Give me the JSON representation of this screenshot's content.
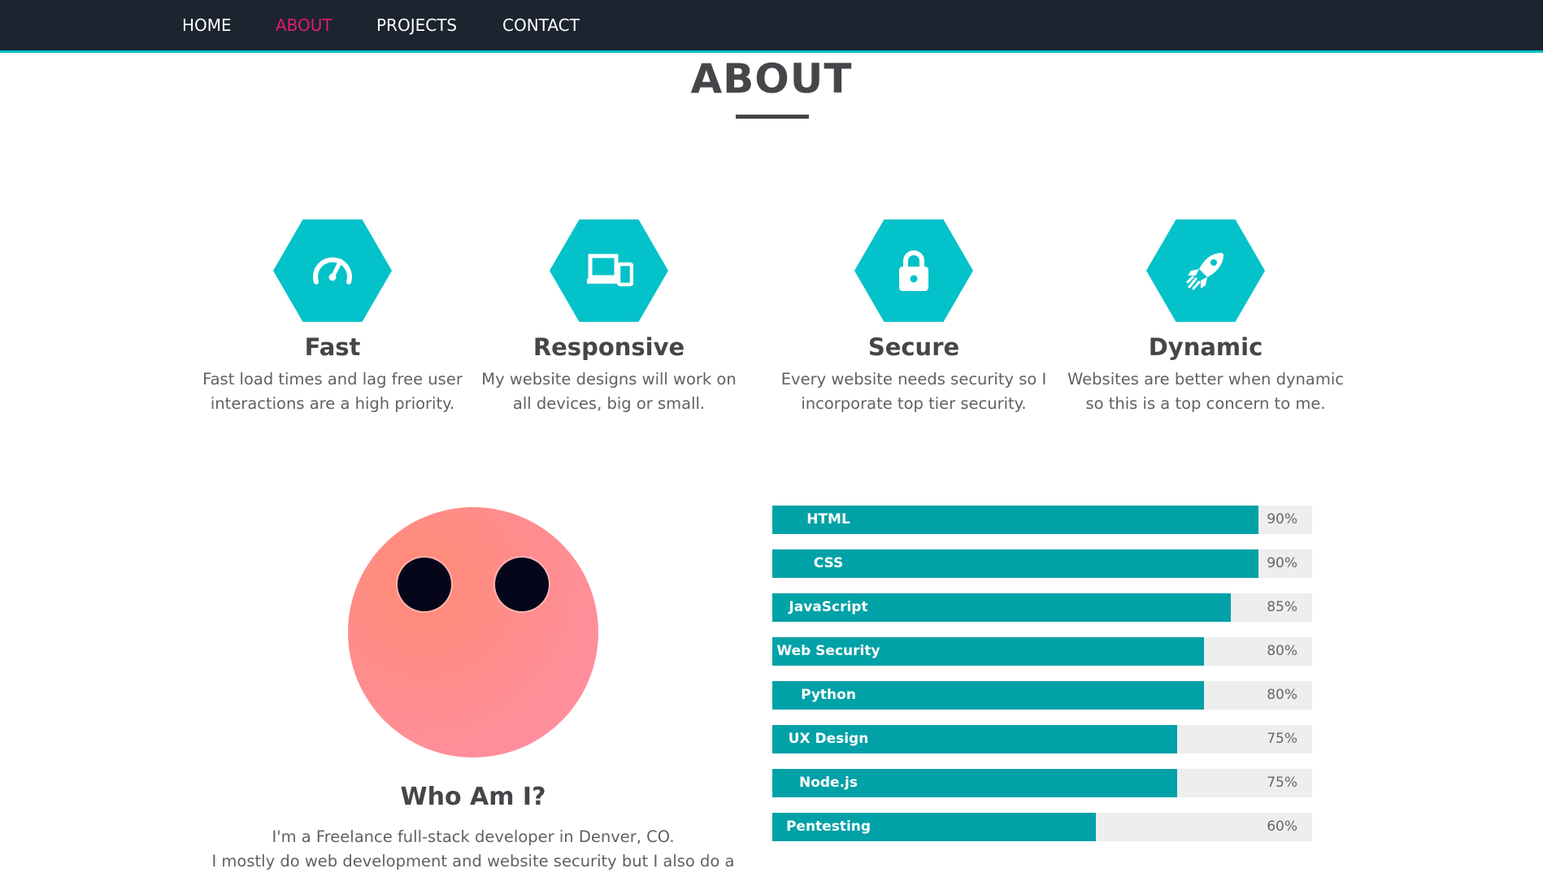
{
  "nav": {
    "items": [
      {
        "label": "HOME",
        "active": false
      },
      {
        "label": "ABOUT",
        "active": true
      },
      {
        "label": "PROJECTS",
        "active": false
      },
      {
        "label": "CONTACT",
        "active": false
      }
    ]
  },
  "section": {
    "title": "ABOUT"
  },
  "features": [
    {
      "icon": "speedometer-icon",
      "title": "Fast",
      "desc_line1": "Fast load times and lag free user",
      "desc_line2": "interactions are a high priority."
    },
    {
      "icon": "devices-icon",
      "title": "Responsive",
      "desc_line1": "My website designs will work on",
      "desc_line2": "all devices, big or small."
    },
    {
      "icon": "lock-icon",
      "title": "Secure",
      "desc_line1": "Every website needs security so I",
      "desc_line2": "incorporate top tier security."
    },
    {
      "icon": "rocket-icon",
      "title": "Dynamic",
      "desc_line1": "Websites are better when dynamic",
      "desc_line2": "so this is a top concern to me."
    }
  ],
  "about": {
    "title": "Who Am I?",
    "line1": "I'm a Freelance full-stack developer in Denver, CO.",
    "line2": "I mostly do web development and website security but I also do a"
  },
  "skills": [
    {
      "name": "HTML",
      "percent": 90,
      "label": "90%"
    },
    {
      "name": "CSS",
      "percent": 90,
      "label": "90%"
    },
    {
      "name": "JavaScript",
      "percent": 85,
      "label": "85%"
    },
    {
      "name": "Web Security",
      "percent": 80,
      "label": "80%"
    },
    {
      "name": "Python",
      "percent": 80,
      "label": "80%"
    },
    {
      "name": "UX Design",
      "percent": 75,
      "label": "75%"
    },
    {
      "name": "Node.js",
      "percent": 75,
      "label": "75%"
    },
    {
      "name": "Pentesting",
      "percent": 60,
      "label": "60%"
    }
  ],
  "colors": {
    "accent": "#04c2c9",
    "accent_dark": "#00a1a7",
    "nav_bg": "#1b242f",
    "nav_active": "#e31b6d",
    "heading": "#444649"
  }
}
